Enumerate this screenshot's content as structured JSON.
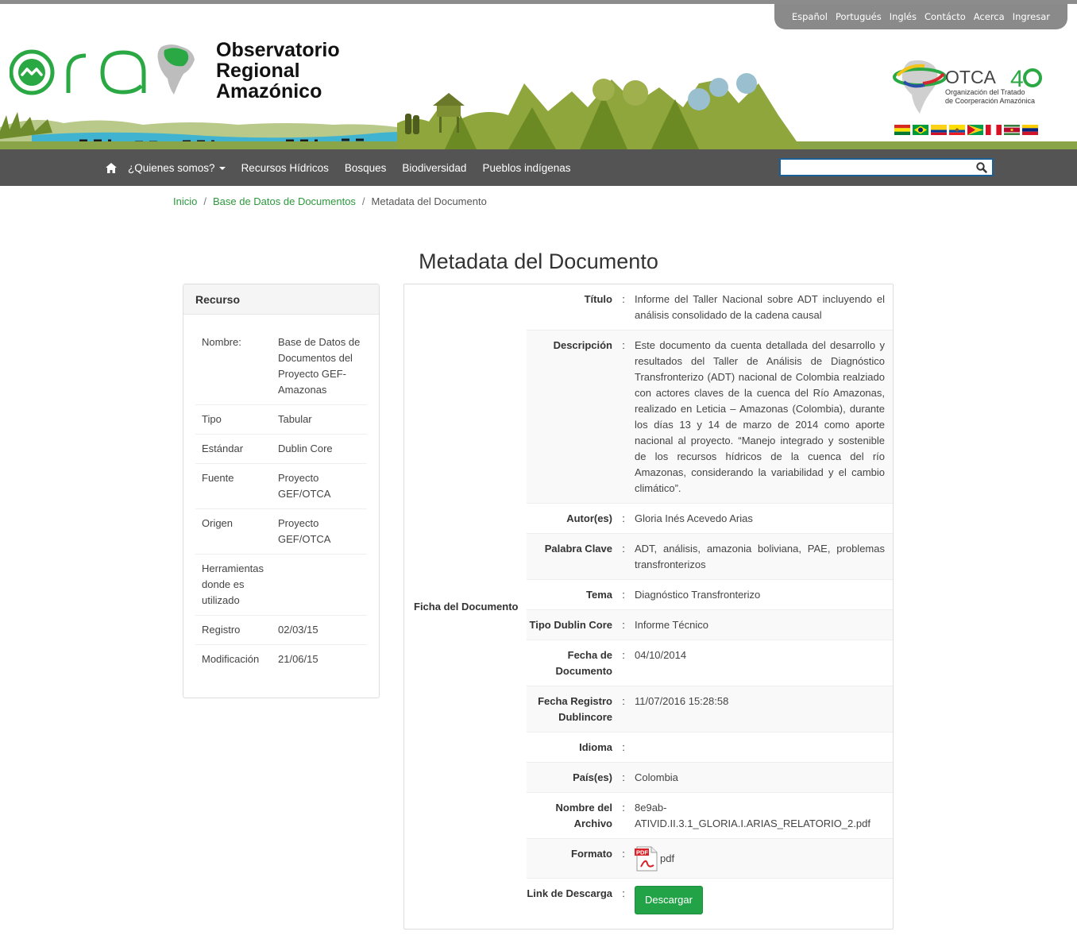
{
  "toplinks": [
    "Español",
    "Portugués",
    "Inglés",
    "Contácto",
    "Acerca",
    "Ingresar"
  ],
  "header": {
    "title_line1": "Observatorio",
    "title_line2": "Regional",
    "title_line3": "Amazónico",
    "otca_name": "OTCA",
    "otca_sub1": "Organización del Tratado",
    "otca_sub2": "de Coorperación Amazónica"
  },
  "nav": {
    "items": [
      "¿Quienes somos?",
      "Recursos Hídricos",
      "Bosques",
      "Biodiversidad",
      "Pueblos indígenas"
    ],
    "search_placeholder": ""
  },
  "breadcrumb": {
    "home": "Inicio",
    "section": "Base de Datos de Documentos",
    "current": "Metadata del Documento",
    "separator": "/"
  },
  "page_title": "Metadata del Documento",
  "recurso": {
    "heading": "Recurso",
    "rows": [
      {
        "label": "Nombre:",
        "value": "Base de Datos de Documentos del Proyecto GEF-Amazonas"
      },
      {
        "label": "Tipo",
        "value": "Tabular"
      },
      {
        "label": "Estándar",
        "value": "Dublin Core"
      },
      {
        "label": "Fuente",
        "value": "Proyecto GEF/OTCA"
      },
      {
        "label": "Origen",
        "value": "Proyecto GEF/OTCA"
      },
      {
        "label": "Herramientas donde es utilizado",
        "value": ""
      },
      {
        "label": "Registro",
        "value": "02/03/15"
      },
      {
        "label": "Modificación",
        "value": "21/06/15"
      }
    ]
  },
  "ficha": {
    "heading": "Ficha del Documento",
    "colon": ":",
    "rows": [
      {
        "label": "Título",
        "value": "Informe del Taller Nacional sobre ADT incluyendo el análisis consolidado de la cadena causal"
      },
      {
        "label": "Descripción",
        "value": "Este documento da cuenta detallada del desarrollo y resultados del Taller de Análisis de Diagnóstico Transfronterizo (ADT) nacional de Colombia realziado con actores claves de la cuenca del Río Amazonas, realizado en Leticia – Amazonas (Colombia), durante los días 13 y 14 de marzo de 2014 como aporte nacional al proyecto. “Manejo integrado y sostenible de los recursos hídricos de la cuenca del río Amazonas, considerando la variabilidad y el cambio climático”."
      },
      {
        "label": "Autor(es)",
        "value": "Gloria Inés Acevedo Arias"
      },
      {
        "label": "Palabra Clave",
        "value": "ADT, análisis, amazonia boliviana, PAE, problemas transfronterizos"
      },
      {
        "label": "Tema",
        "value": "Diagnóstico Transfronterizo"
      },
      {
        "label": "Tipo Dublin Core",
        "value": "Informe Técnico"
      },
      {
        "label": "Fecha de Documento",
        "value": "04/10/2014"
      },
      {
        "label": "Fecha Registro Dublincore",
        "value": "11/07/2016 15:28:58"
      },
      {
        "label": "Idioma",
        "value": ""
      },
      {
        "label": "País(es)",
        "value": "Colombia"
      },
      {
        "label": "Nombre del Archivo",
        "value": "8e9ab-ATIVID.II.3.1_GLORIA.I.ARIAS_RELATORIO_2.pdf"
      },
      {
        "label": "Formato",
        "value": "pdf"
      },
      {
        "label": "Link de Descarga",
        "value": "Descargar"
      }
    ]
  },
  "icons": {
    "home": "home-icon",
    "search": "search-icon",
    "pdf": "pdf-file-icon"
  },
  "colors": {
    "navbar": "#545454",
    "link_green": "#2c9a3c",
    "button_green": "#22a347",
    "logo_green": "#2aa843"
  }
}
